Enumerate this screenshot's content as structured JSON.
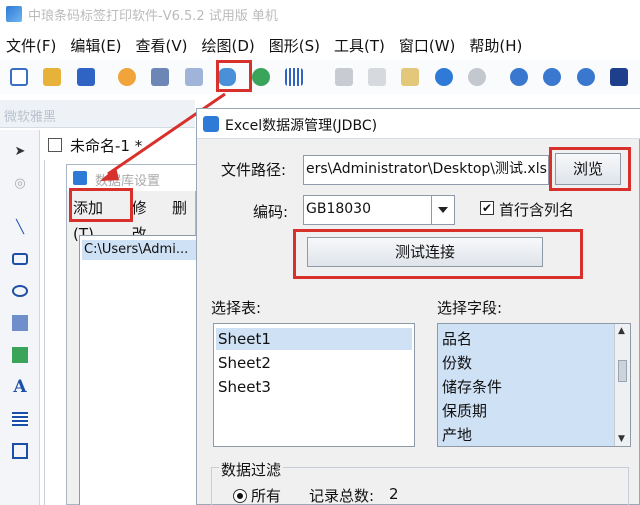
{
  "window": {
    "title": "中琅条码标签打印软件-V6.5.2 试用版 单机"
  },
  "menubar": [
    "文件(F)",
    "编辑(E)",
    "查看(V)",
    "绘图(D)",
    "图形(S)",
    "工具(T)",
    "窗口(W)",
    "帮助(H)"
  ],
  "panel": {
    "faded_label": "微软雅黑"
  },
  "document_tab": {
    "label": "未命名-1 *"
  },
  "datasource_dialog": {
    "title": "数据库设置",
    "menu": [
      "添加(T)",
      "修改",
      "删"
    ],
    "sources": [
      "C:\\Users\\Admi..."
    ]
  },
  "excel_dialog": {
    "title": "Excel数据源管理(JDBC)",
    "file_path_label": "文件路径:",
    "file_path_value": "ers\\Administrator\\Desktop\\测试.xls",
    "browse_label": "浏览",
    "encoding_label": "编码:",
    "encoding_value": "GB18030",
    "first_row_label": "首行含列名",
    "first_row_checked": true,
    "test_button": "测试连接",
    "select_table_label": "选择表:",
    "tables": [
      "Sheet1",
      "Sheet2",
      "Sheet3"
    ],
    "select_field_label": "选择字段:",
    "fields": [
      "品名",
      "份数",
      "储存条件",
      "保质期",
      "产地"
    ],
    "filter_group_label": "数据过滤",
    "filter_all_label": "所有",
    "record_total_label": "记录总数:",
    "record_total_value": "2"
  },
  "colors": {
    "highlight": "#d8302b",
    "selection": "#cfe1f5",
    "accent": "#2d7bd6"
  }
}
